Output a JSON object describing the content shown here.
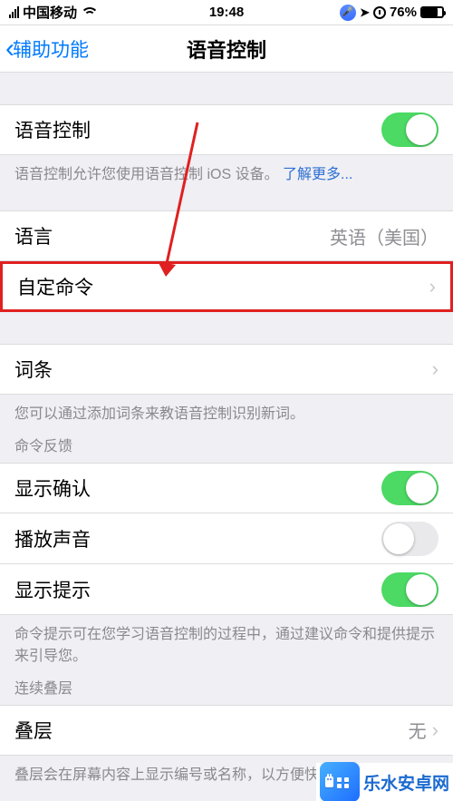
{
  "status": {
    "carrier": "中国移动",
    "time": "19:48",
    "battery_pct": "76%"
  },
  "nav": {
    "back_label": "辅助功能",
    "title": "语音控制"
  },
  "voice_control": {
    "label": "语音控制",
    "footer_pre_link": "语音控制允许您使用语音控制 iOS 设备。",
    "footer_link": "了解更多..."
  },
  "language": {
    "label": "语言",
    "value": "英语（美国）"
  },
  "custom_commands": {
    "label": "自定命令"
  },
  "vocab": {
    "label": "词条",
    "footer": "您可以通过添加词条来教语音控制识别新词。"
  },
  "feedback": {
    "header": "命令反馈",
    "show_confirm_label": "显示确认",
    "play_sound_label": "播放声音",
    "show_hints_label": "显示提示",
    "footer": "命令提示可在您学习语音控制的过程中，通过建议命令和提供提示来引导您。"
  },
  "overlay": {
    "header": "连续叠层",
    "label": "叠层",
    "value": "无",
    "footer": "叠层会在屏幕内容上显示编号或名称，以方便快"
  },
  "watermark": {
    "text": "乐水安卓网"
  }
}
